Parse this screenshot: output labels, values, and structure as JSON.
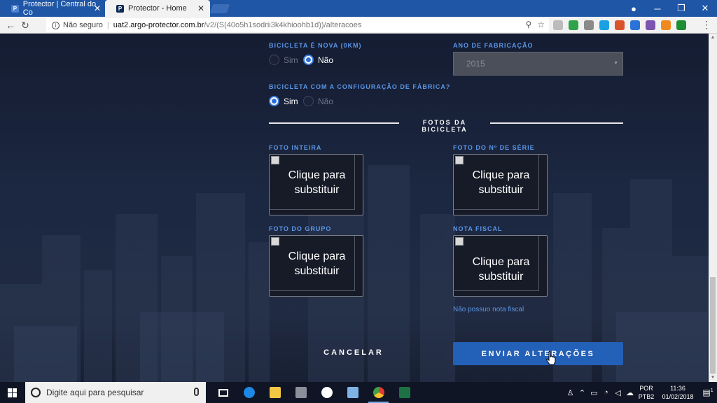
{
  "browser": {
    "tabs": [
      {
        "title": "Protector | Central do Co",
        "favicon": "P",
        "active": false
      },
      {
        "title": "Protector - Home",
        "favicon": "P",
        "active": true
      }
    ],
    "address": {
      "security_label": "Não seguro",
      "host": "uat2.argo-protector.com.br",
      "path": "/v2/(S(40o5h1sodrii3k4khioohb1d))/alteracoes"
    },
    "extension_colors": [
      "#bcbcbc",
      "#2fa34a",
      "#8a8a8a",
      "#1ba1e2",
      "#d9532c",
      "#2a73d8",
      "#7b55b0",
      "#f08a1f",
      "#1d8e31"
    ]
  },
  "form": {
    "is_new": {
      "label": "BICICLETA É NOVA (0KM)",
      "options": [
        "Sim",
        "Não"
      ],
      "selected": "Não"
    },
    "year": {
      "label": "ANO DE FABRICAÇÃO",
      "value": "2015"
    },
    "factory_config": {
      "label": "BICICLETA COM A CONFIGURAÇÃO DE FÁBRICA?",
      "options": [
        "Sim",
        "Não"
      ],
      "selected": "Sim"
    },
    "photos_section_title": "FOTOS DA BICICLETA",
    "photos": [
      {
        "label": "FOTO INTEIRA",
        "caption": "Clique para substituir"
      },
      {
        "label": "FOTO DO Nº DE SÉRIE",
        "caption": "Clique para substituir"
      },
      {
        "label": "FOTO DO GRUPO",
        "caption": "Clique para substituir"
      },
      {
        "label": "NOTA FISCAL",
        "caption": "Clique para substituir"
      }
    ],
    "no_invoice_link": "Não possuo nota fiscal",
    "cancel_label": "CANCELAR",
    "submit_label": "ENVIAR ALTERAÇÕES"
  },
  "taskbar": {
    "search_placeholder": "Digite aqui para pesquisar",
    "lang_line1": "POR",
    "lang_line2": "PTB2",
    "time": "11:36",
    "date": "01/02/2018",
    "notification_count": "1"
  },
  "colors": {
    "accent": "#2360b8",
    "label": "#5b95e6",
    "chrome_tabstrip": "#1f56a6"
  }
}
